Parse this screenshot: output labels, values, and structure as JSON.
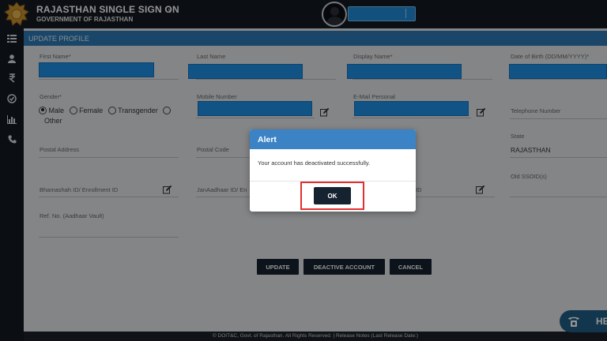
{
  "header": {
    "title": "RAJASTHAN SINGLE SIGN ON",
    "title_caret": "v",
    "subtitle": "GOVERNMENT OF RAJASTHAN"
  },
  "section_title": "UPDATE PROFILE",
  "form": {
    "first_name_label": "First Name*",
    "last_name_label": "Last Name",
    "display_name_label": "Display Name*",
    "dob_label": "Date of Birth (DD/MM/YYYY)*",
    "gender_label": "Gender*",
    "gender_options": [
      "Male",
      "Female",
      "Transgender",
      "Other"
    ],
    "mobile_label": "Mobile Number",
    "email_label": "E-Mail Personal",
    "telephone_label": "Telephone Number",
    "state_label": "State",
    "state_value": "RAJASTHAN",
    "postal_address_label": "Postal Address",
    "postal_code_label": "Postal Code",
    "old_ssoid_label": "Old SSOID(s)",
    "bhamashah_label": "Bhamashah ID/ Enrollment ID",
    "janaadhaar_label": "JanAadhaar ID/ En",
    "id_label": "ID",
    "ref_no_label": "Ref. No. (Aadhaar Vault)"
  },
  "buttons": {
    "update": "UPDATE",
    "deactivate": "DEACTIVE ACCOUNT",
    "cancel": "CANCEL"
  },
  "footer": "© DOIT&C, Govt. of Rajasthan. All Rights Reserved.  |  Release Notes (Last Release Date:)",
  "help": {
    "label": "HE"
  },
  "modal": {
    "title": "Alert",
    "message": "Your account has deactivated successfully.",
    "ok_label": "OK"
  },
  "icons": {
    "sidebar": [
      "menu-icon",
      "user-icon",
      "rupee-icon",
      "check-circle-icon",
      "bar-chart-icon",
      "phone-icon"
    ]
  },
  "colors": {
    "header_bg": "#141922",
    "section_header": "#2d7bb6",
    "highlight_fill": "#1e90e6",
    "modal_header": "#3b83c4",
    "button_dark": "#15222f",
    "focus_outline": "#e03131"
  }
}
